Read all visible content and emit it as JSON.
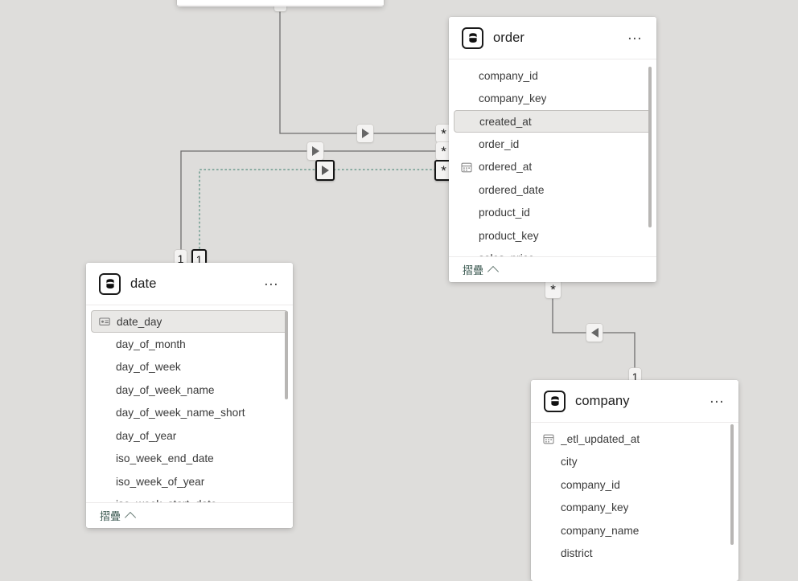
{
  "canvas": {
    "background": "#dedddb",
    "accent_link_color": "#3c5a52",
    "selected_edge_color": "#6f9b90"
  },
  "tables": [
    {
      "id": "order",
      "title": "order",
      "icon": "database-icon",
      "menu": "…",
      "footer_label": "摺疊",
      "fields": [
        {
          "name": "company_id",
          "icon": "none",
          "selected": false
        },
        {
          "name": "company_key",
          "icon": "none",
          "selected": false
        },
        {
          "name": "created_at",
          "icon": "none",
          "selected": true
        },
        {
          "name": "order_id",
          "icon": "none",
          "selected": false
        },
        {
          "name": "ordered_at",
          "icon": "calendar-icon",
          "selected": false
        },
        {
          "name": "ordered_date",
          "icon": "none",
          "selected": false
        },
        {
          "name": "product_id",
          "icon": "none",
          "selected": false
        },
        {
          "name": "product_key",
          "icon": "none",
          "selected": false
        },
        {
          "name": "sales_price",
          "icon": "none",
          "selected": false
        }
      ]
    },
    {
      "id": "date",
      "title": "date",
      "icon": "database-icon",
      "menu": "…",
      "footer_label": "摺疊",
      "fields": [
        {
          "name": "date_day",
          "icon": "key-card-icon",
          "selected": true
        },
        {
          "name": "day_of_month",
          "icon": "none",
          "selected": false
        },
        {
          "name": "day_of_week",
          "icon": "none",
          "selected": false
        },
        {
          "name": "day_of_week_name",
          "icon": "none",
          "selected": false
        },
        {
          "name": "day_of_week_name_short",
          "icon": "none",
          "selected": false
        },
        {
          "name": "day_of_year",
          "icon": "none",
          "selected": false
        },
        {
          "name": "iso_week_end_date",
          "icon": "none",
          "selected": false
        },
        {
          "name": "iso_week_of_year",
          "icon": "none",
          "selected": false
        },
        {
          "name": "iso_week_start_date",
          "icon": "none",
          "selected": false
        }
      ]
    },
    {
      "id": "company",
      "title": "company",
      "icon": "database-icon",
      "menu": "…",
      "footer_label": "摺疊",
      "fields": [
        {
          "name": "_etl_updated_at",
          "icon": "calendar-icon",
          "selected": false
        },
        {
          "name": "city",
          "icon": "none",
          "selected": false
        },
        {
          "name": "company_id",
          "icon": "none",
          "selected": false
        },
        {
          "name": "company_key",
          "icon": "none",
          "selected": false
        },
        {
          "name": "company_name",
          "icon": "none",
          "selected": false
        },
        {
          "name": "district",
          "icon": "none",
          "selected": false
        }
      ]
    }
  ],
  "relationships": [
    {
      "id": "rel-1",
      "from_cardinality": "*",
      "to_cardinality": "1",
      "marker": "▶",
      "selected": false
    },
    {
      "id": "rel-2",
      "from_cardinality": "*",
      "to_cardinality": "1",
      "marker": "▶",
      "selected": false
    },
    {
      "id": "rel-3",
      "from_cardinality": "*",
      "to_cardinality": "1",
      "marker": "▶",
      "selected": true
    },
    {
      "id": "rel-4",
      "from_cardinality": "*",
      "to_cardinality": "1",
      "marker": "◀",
      "selected": false
    }
  ],
  "badges": {
    "many": "*",
    "one": "1"
  }
}
